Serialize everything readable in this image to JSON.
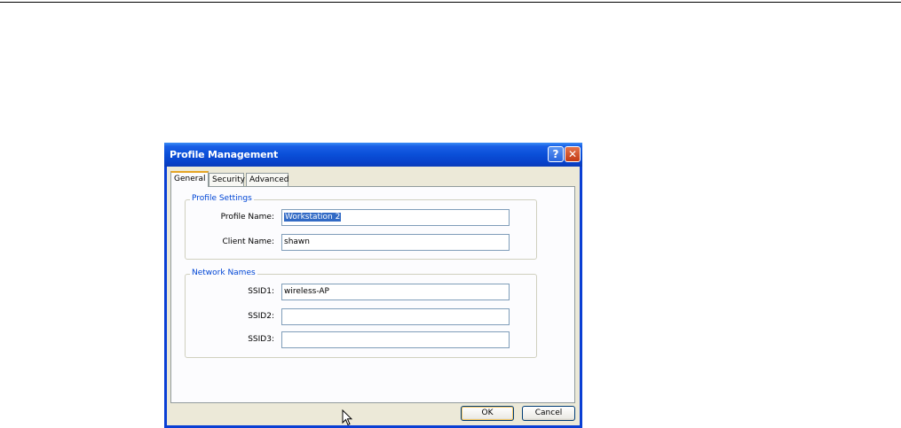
{
  "window": {
    "title": "Profile Management",
    "help_symbol": "?",
    "close_symbol": "✕"
  },
  "tabs": [
    {
      "label": "General",
      "active": true
    },
    {
      "label": "Security",
      "active": false
    },
    {
      "label": "Advanced",
      "active": false
    }
  ],
  "profile_settings": {
    "group_title": "Profile Settings",
    "profile_name_label": "Profile Name:",
    "profile_name_value": "Workstation 2",
    "client_name_label": "Client Name:",
    "client_name_value": "shawn"
  },
  "network_names": {
    "group_title": "Network Names",
    "ssid1_label": "SSID1:",
    "ssid1_value": "wireless-AP",
    "ssid2_label": "SSID2:",
    "ssid2_value": "",
    "ssid3_label": "SSID3:",
    "ssid3_value": ""
  },
  "buttons": {
    "ok_label": "OK",
    "cancel_label": "Cancel"
  },
  "colors": {
    "titlebar": "#0a4fd8",
    "group_title": "#0046d5",
    "selection": "#316ac5"
  },
  "icons": [
    "help-icon",
    "close-icon",
    "mouse-cursor-icon"
  ]
}
